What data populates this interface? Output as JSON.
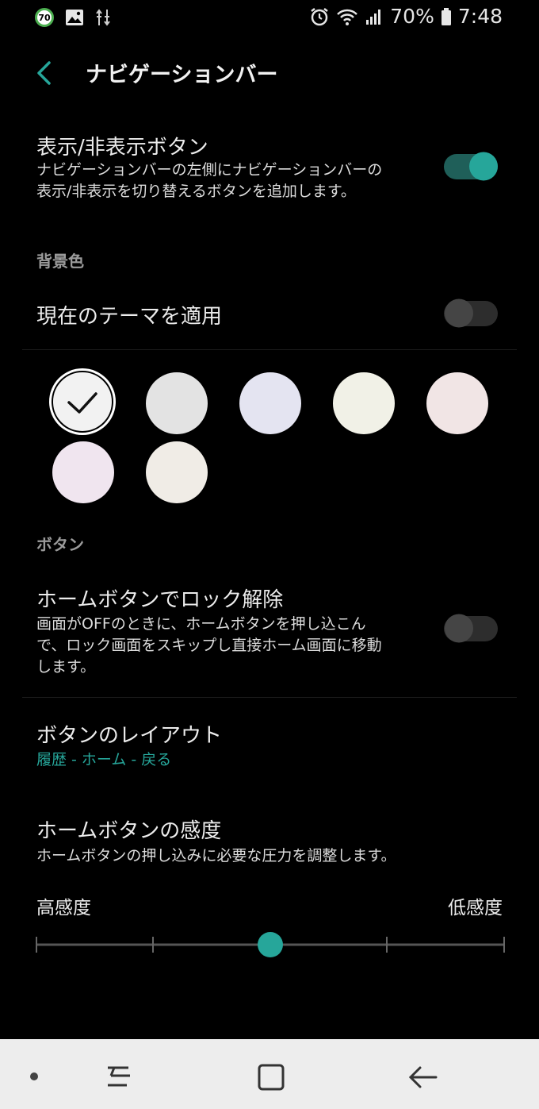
{
  "status_bar": {
    "notification_badge": "70",
    "battery_percent": "70%",
    "time": "7:48",
    "icons": [
      "image-icon",
      "data-transfer-icon",
      "alarm-icon",
      "wifi-icon",
      "signal-icon",
      "battery-icon"
    ]
  },
  "header": {
    "title": "ナビゲーションバー"
  },
  "show_hide": {
    "title": "表示/非表示ボタン",
    "desc_line1": "ナビゲーションバーの左側にナビゲーションバーの",
    "desc_line2": "表示/非表示を切り替えるボタンを追加します。",
    "enabled": true
  },
  "background": {
    "section": "背景色",
    "apply_theme": "現在のテーマを適用",
    "apply_theme_enabled": false,
    "swatches": [
      "#f2f2f2",
      "#e3e3e3",
      "#e4e4f1",
      "#f1f1e7",
      "#f1e5e5",
      "#f0e5ef",
      "#f0ece6"
    ],
    "selected_index": 0
  },
  "buttons": {
    "section": "ボタン",
    "unlock_title": "ホームボタンでロック解除",
    "unlock_desc1": "画面がOFFのときに、ホームボタンを押し込こん",
    "unlock_desc2": "で、ロック画面をスキップし直接ホーム画面に移動",
    "unlock_desc3": "します。",
    "unlock_enabled": false,
    "layout_title": "ボタンのレイアウト",
    "layout_value": "履歴 - ホーム - 戻る",
    "sensitivity_title": "ホームボタンの感度",
    "sensitivity_desc": "ホームボタンの押し込みに必要な圧力を調整します。",
    "sensitivity_low_label": "高感度",
    "sensitivity_high_label": "低感度",
    "sensitivity_steps": 5,
    "sensitivity_level": 2
  },
  "colors": {
    "accent": "#26a69a",
    "accent_dark_track": "#1f5f59"
  }
}
